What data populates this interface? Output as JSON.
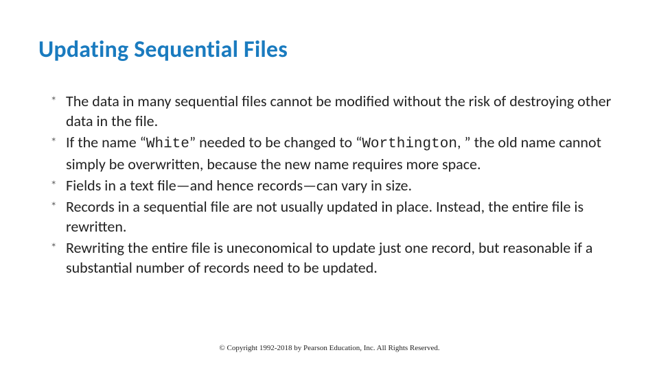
{
  "title": "Updating Sequential  Files",
  "bullets": [
    {
      "pre": "The data in many sequential files cannot be modified without the risk of destroying other data in the file."
    },
    {
      "pre": "If the name “",
      "code1": "White",
      "mid": "” needed to be changed to “",
      "code2": "Worthington",
      "post": ", ” the old name cannot simply be overwritten, because the new name requires more space."
    },
    {
      "pre": "Fields in a text file—and hence records—can vary in size."
    },
    {
      "pre": "Records in a sequential file are not usually updated in place. Instead, the entire file is rewritten."
    },
    {
      "pre": "Rewriting the entire file is uneconomical to update just one record, but reasonable if a substantial number of records need to be updated."
    }
  ],
  "footer": "© Copyright 1992-2018 by Pearson Education, Inc. All Rights Reserved."
}
